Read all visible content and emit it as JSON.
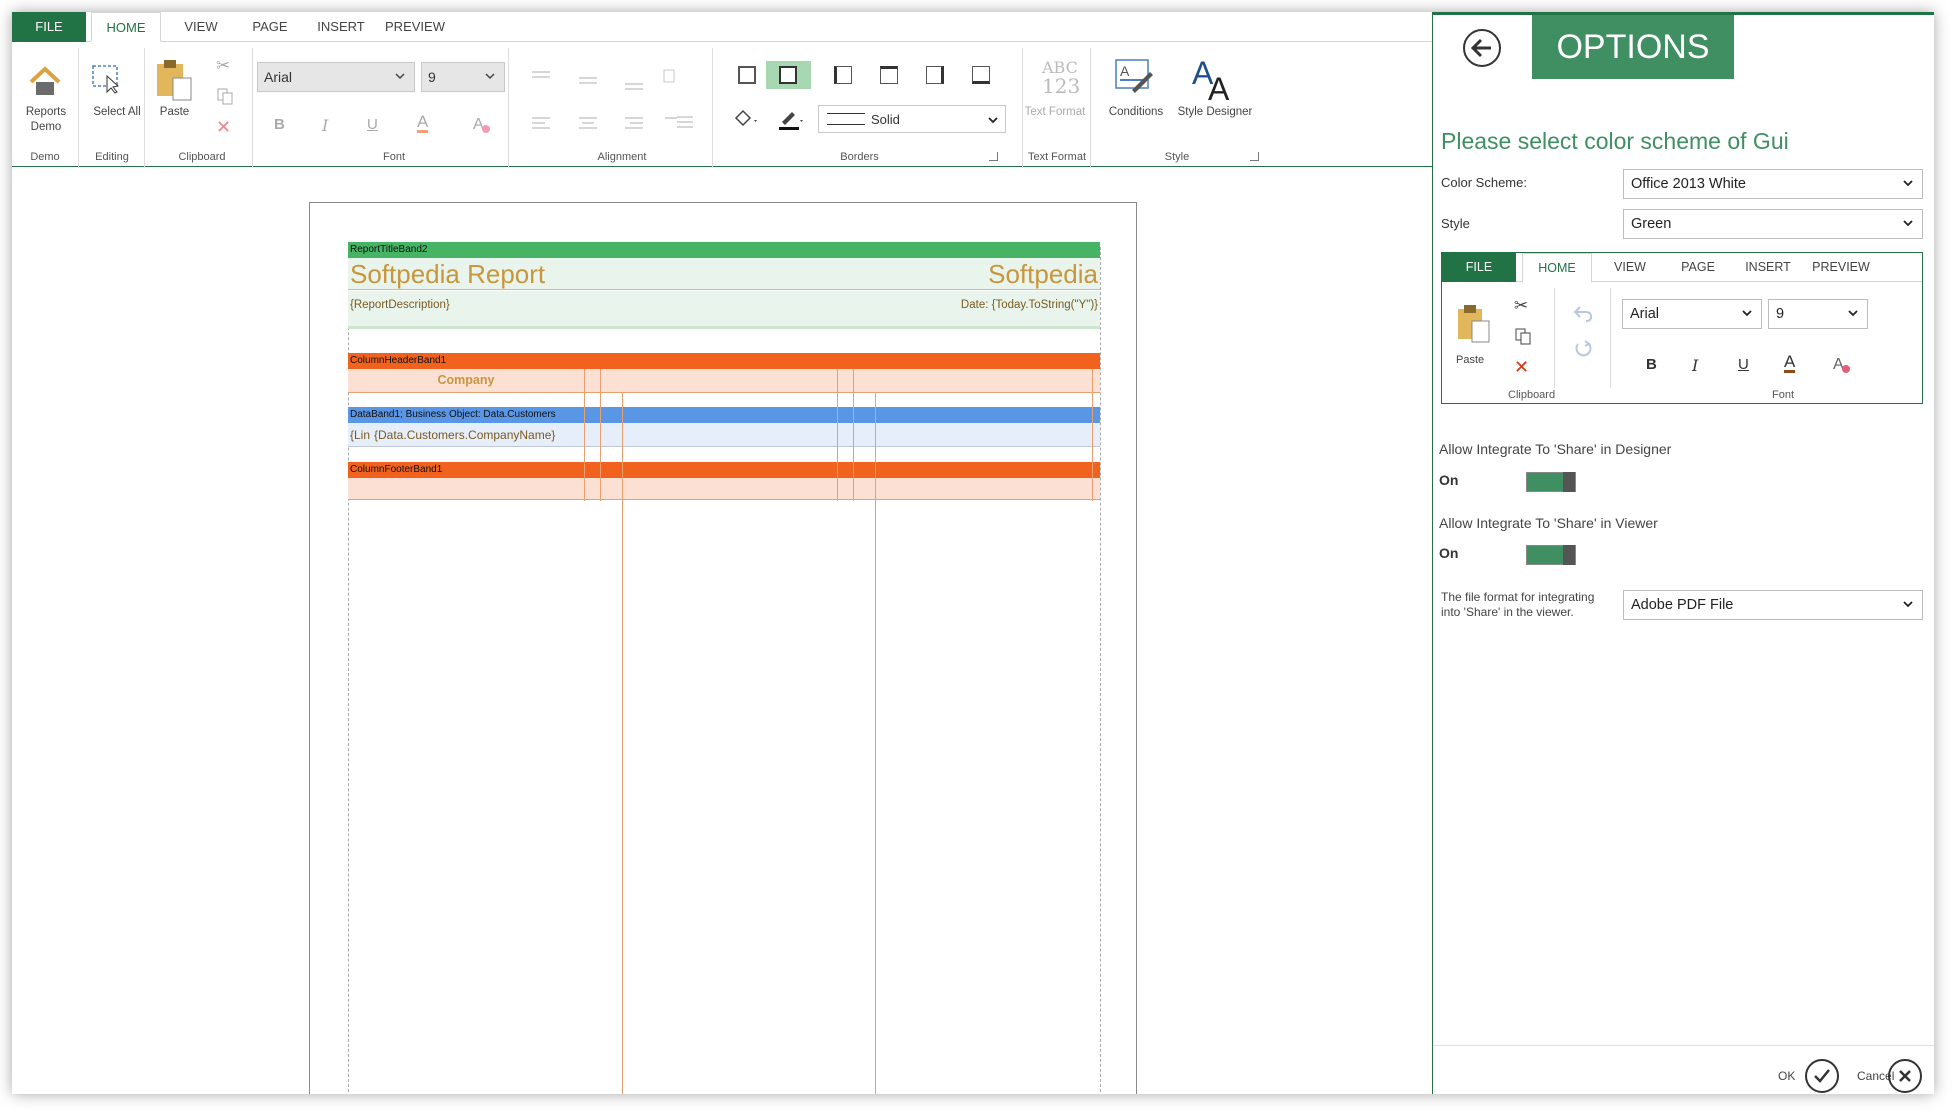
{
  "ribbon": {
    "tabs": [
      "FILE",
      "HOME",
      "VIEW",
      "PAGE",
      "INSERT",
      "PREVIEW"
    ],
    "buttons": {
      "reports_demo": "Reports Demo",
      "select_all": "Select All",
      "paste": "Paste",
      "text_format": "Text Format",
      "conditions": "Conditions",
      "style_designer": "Style Designer",
      "text_format_glyph_top": "ABC",
      "text_format_glyph_bottom": "123"
    },
    "font_name": "Arial",
    "font_size": "9",
    "border_style": "Solid",
    "groups": [
      "Demo",
      "Editing",
      "Clipboard",
      "Font",
      "Alignment",
      "Borders",
      "Text Format",
      "Style"
    ],
    "format_letters": {
      "bold": "B",
      "italic": "I",
      "underline": "U",
      "font_color": "A"
    }
  },
  "report": {
    "title_band": "ReportTitleBand2",
    "title": "Softpedia Report",
    "title_right": "Softpedia",
    "description": "{ReportDescription}",
    "date": "Date: {Today.ToString(\"Y\")}",
    "column_header_band": "ColumnHeaderBand1",
    "company_header": "Company",
    "data_band": "DataBand1; Business Object: Data.Customers",
    "line_cell": "{Lin",
    "company_cell": "{Data.Customers.CompanyName}",
    "column_footer_band": "ColumnFooterBand1"
  },
  "options": {
    "title": "OPTIONS",
    "heading": "Please select color scheme of Gui",
    "color_scheme_label": "Color Scheme:",
    "color_scheme_value": "Office 2013 White",
    "style_label": "Style",
    "style_value": "Green",
    "preview": {
      "tabs": [
        "FILE",
        "HOME",
        "VIEW",
        "PAGE",
        "INSERT",
        "PREVIEW"
      ],
      "paste": "Paste",
      "font_name": "Arial",
      "font_size": "9",
      "clipboard_group": "Clipboard",
      "font_group": "Font",
      "letters": {
        "bold": "B",
        "italic": "I",
        "underline": "U",
        "font_color": "A"
      }
    },
    "share_designer_label": "Allow Integrate To 'Share' in Designer",
    "share_designer_state": "On",
    "share_viewer_label": "Allow Integrate To 'Share' in Viewer",
    "share_viewer_state": "On",
    "file_format_label_1": "The file format for integrating",
    "file_format_label_2": "into 'Share' in the viewer.",
    "file_format_value": "Adobe PDF File",
    "ok": "OK",
    "cancel": "Cancel"
  },
  "colors": {
    "accent": "#217346",
    "title_band": "#46b464",
    "header_band": "#f0621e",
    "data_band": "#5a96e6",
    "report_text": "#c8963c"
  }
}
